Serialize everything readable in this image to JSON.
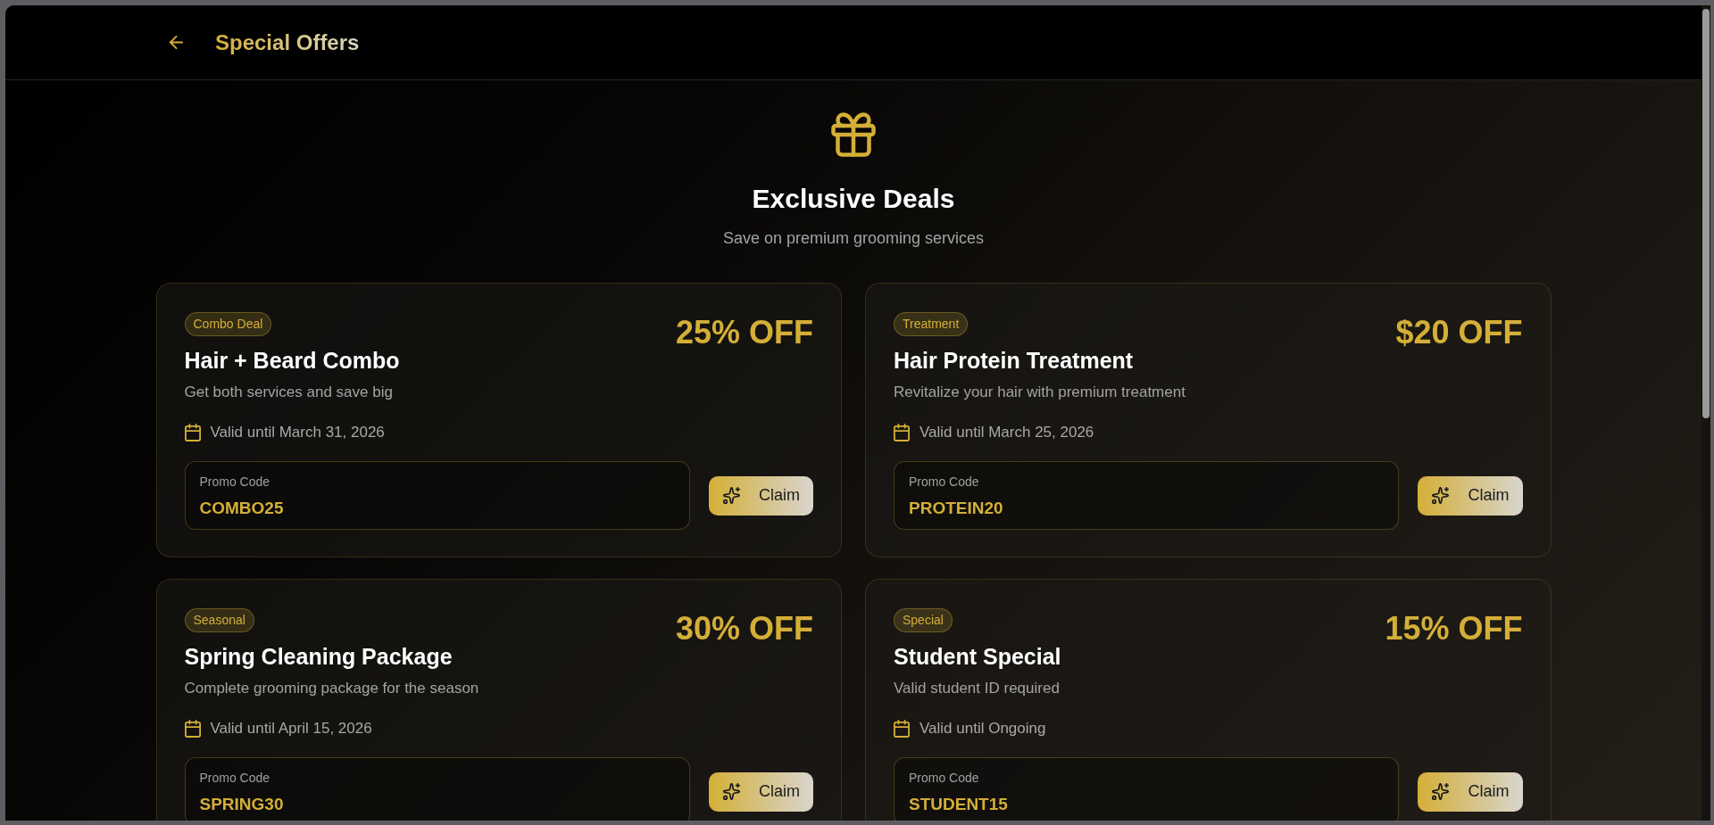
{
  "header": {
    "title": "Special Offers"
  },
  "hero": {
    "title": "Exclusive Deals",
    "subtitle": "Save on premium grooming services"
  },
  "offers": [
    {
      "category": "Combo Deal",
      "title": "Hair + Beard Combo",
      "description": "Get both services and save big",
      "valid": "Valid until March 31, 2026",
      "discount": "25% OFF",
      "promo_label": "Promo Code",
      "promo_code": "COMBO25",
      "button": "Claim"
    },
    {
      "category": "Treatment",
      "title": "Hair Protein Treatment",
      "description": "Revitalize your hair with premium treatment",
      "valid": "Valid until March 25, 2026",
      "discount": "$20 OFF",
      "promo_label": "Promo Code",
      "promo_code": "PROTEIN20",
      "button": "Claim"
    },
    {
      "category": "Seasonal",
      "title": "Spring Cleaning Package",
      "description": "Complete grooming package for the season",
      "valid": "Valid until April 15, 2026",
      "discount": "30% OFF",
      "promo_label": "Promo Code",
      "promo_code": "SPRING30",
      "button": "Claim"
    },
    {
      "category": "Special",
      "title": "Student Special",
      "description": "Valid student ID required",
      "valid": "Valid until Ongoing",
      "discount": "15% OFF",
      "promo_label": "Promo Code",
      "promo_code": "STUDENT15",
      "button": "Claim"
    }
  ]
}
